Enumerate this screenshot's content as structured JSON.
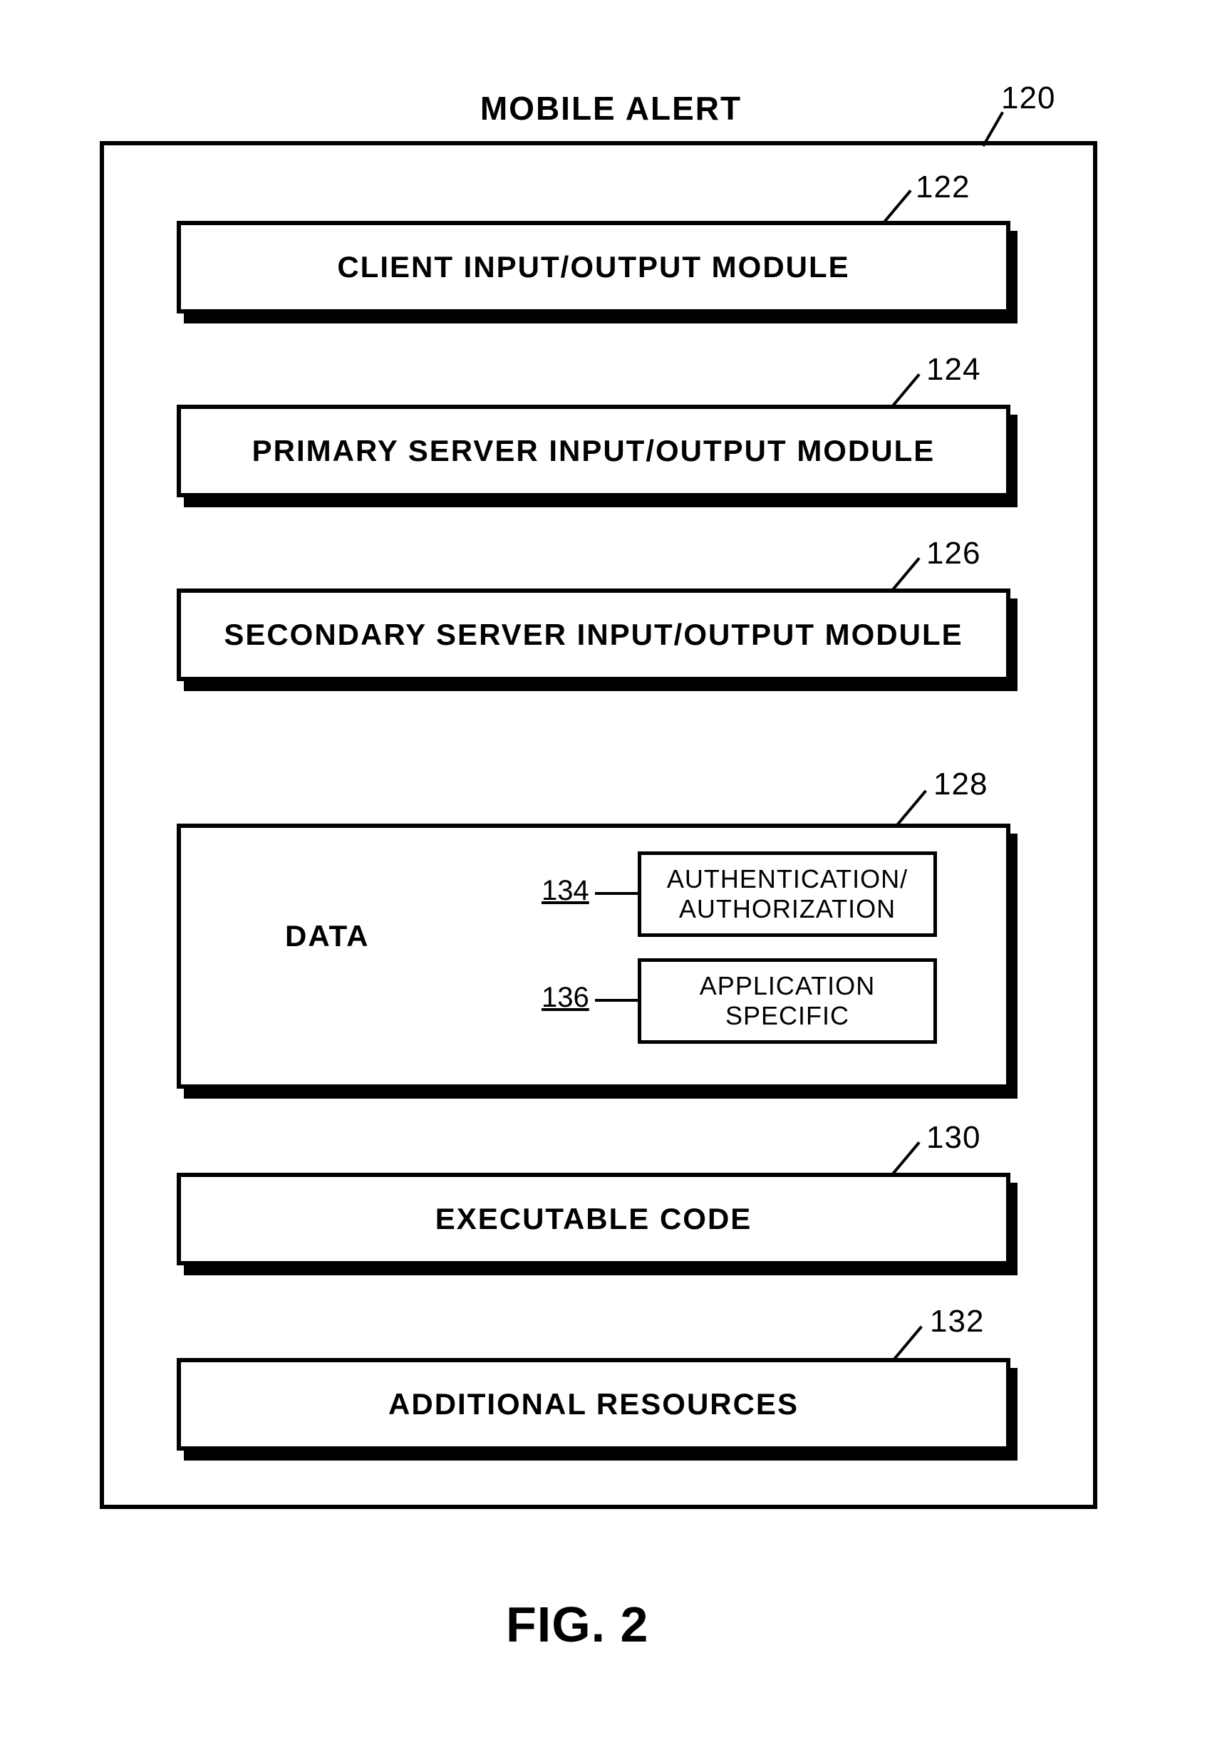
{
  "diagram": {
    "title": "MOBILE ALERT",
    "outer_ref": "120",
    "modules": {
      "client_io": {
        "label": "CLIENT INPUT/OUTPUT MODULE",
        "ref": "122"
      },
      "primary_io": {
        "label": "PRIMARY SERVER INPUT/OUTPUT MODULE",
        "ref": "124"
      },
      "secondary_io": {
        "label": "SECONDARY SERVER INPUT/OUTPUT MODULE",
        "ref": "126"
      },
      "data": {
        "label": "DATA",
        "ref": "128",
        "sub": {
          "auth": {
            "label": "AUTHENTICATION/\nAUTHORIZATION",
            "ref": "134"
          },
          "app_specific": {
            "label": "APPLICATION\nSPECIFIC",
            "ref": "136"
          }
        }
      },
      "exec_code": {
        "label": "EXECUTABLE CODE",
        "ref": "130"
      },
      "add_res": {
        "label": "ADDITIONAL RESOURCES",
        "ref": "132"
      }
    },
    "figure_caption": "FIG. 2"
  }
}
